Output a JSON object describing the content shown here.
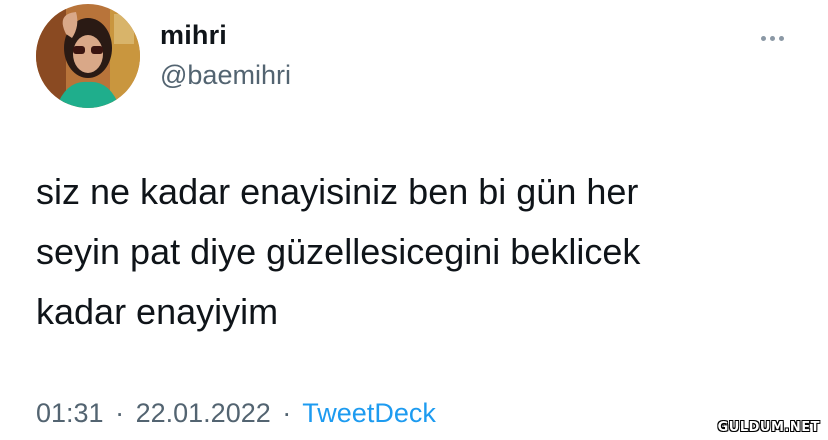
{
  "tweet": {
    "author": {
      "display_name": "mihri",
      "handle": "@baemihri"
    },
    "more_icon": "more-horizontal-icon",
    "text_lines": [
      "siz ne kadar enayisiniz ben bi gün her",
      "seyin pat diye güzellesicegini beklicek",
      "kadar enayiyim"
    ],
    "time": "01:31",
    "date": "22.01.2022",
    "separator": "·",
    "source": "TweetDeck"
  },
  "watermark": "GULDUM.NET",
  "colors": {
    "text": "#0f1419",
    "secondary": "#536471",
    "link": "#1d9bf0",
    "background": "#ffffff"
  }
}
